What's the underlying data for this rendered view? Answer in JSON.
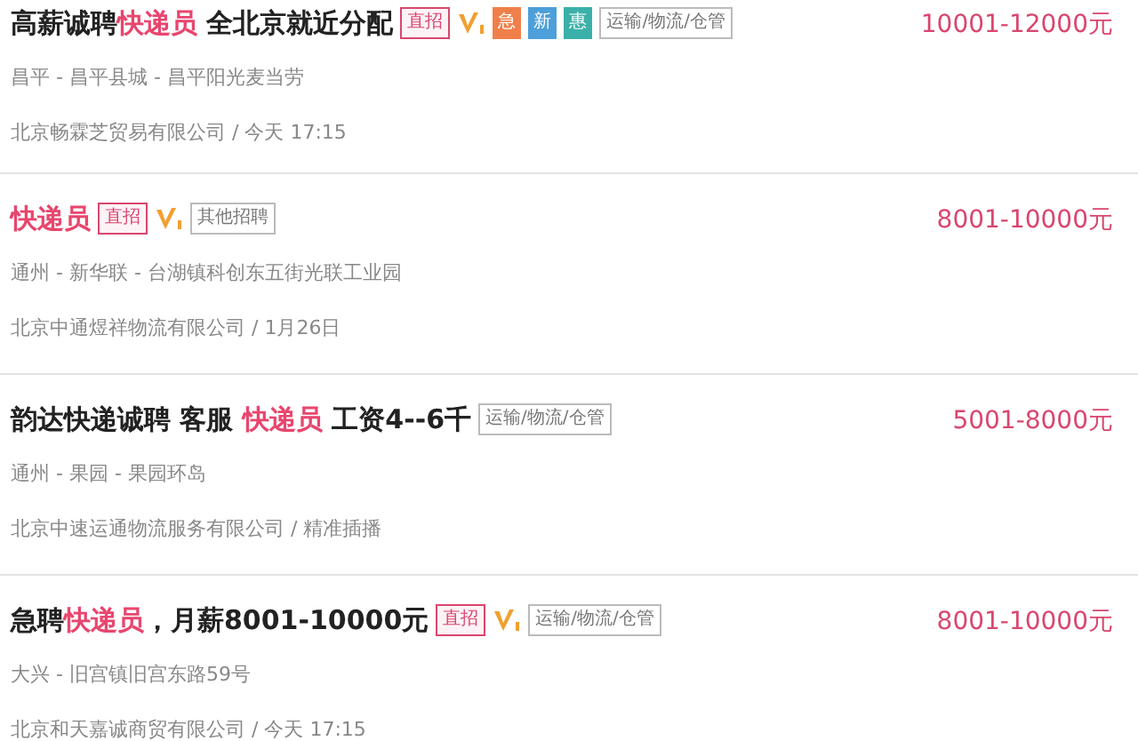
{
  "jobs": [
    {
      "title": [
        {
          "text": "高薪诚聘",
          "highlight": false
        },
        {
          "text": "快递员",
          "highlight": true
        },
        {
          "text": " 全北京就近分配",
          "highlight": false
        }
      ],
      "badges": [
        {
          "kind": "direct",
          "text": "直招"
        },
        {
          "kind": "verified"
        },
        {
          "kind": "urgent",
          "text": "急"
        },
        {
          "kind": "new",
          "text": "新"
        },
        {
          "kind": "benefit",
          "text": "惠"
        },
        {
          "kind": "category",
          "text": "运输/物流/仓管"
        }
      ],
      "salary": "10001-12000元",
      "location": "昌平 - 昌平县城 - 昌平阳光麦当劳",
      "company": "北京畅霖芝贸易有限公司 / 今天 17:15"
    },
    {
      "title": [
        {
          "text": "快递员",
          "highlight": true
        }
      ],
      "badges": [
        {
          "kind": "direct",
          "text": "直招"
        },
        {
          "kind": "verified"
        },
        {
          "kind": "category",
          "text": "其他招聘"
        }
      ],
      "salary": "8001-10000元",
      "location": "通州 - 新华联 - 台湖镇科创东五街光联工业园",
      "company": "北京中通煜祥物流有限公司 / 1月26日"
    },
    {
      "title": [
        {
          "text": "韵达快递诚聘 客服 ",
          "highlight": false
        },
        {
          "text": "快递员",
          "highlight": true
        },
        {
          "text": " 工资4--6千",
          "highlight": false
        }
      ],
      "badges": [
        {
          "kind": "category",
          "text": "运输/物流/仓管"
        }
      ],
      "salary": "5001-8000元",
      "location": "通州 - 果园 - 果园环岛",
      "company": "北京中速运通物流服务有限公司 / 精准插播"
    },
    {
      "title": [
        {
          "text": "急聘",
          "highlight": false
        },
        {
          "text": "快递员",
          "highlight": true
        },
        {
          "text": "，月薪8001-10000元",
          "highlight": false
        }
      ],
      "badges": [
        {
          "kind": "direct",
          "text": "直招"
        },
        {
          "kind": "verified"
        },
        {
          "kind": "category",
          "text": "运输/物流/仓管"
        }
      ],
      "salary": "8001-10000元",
      "location": "大兴 - 旧宫镇旧宫东路59号",
      "company": "北京和天嘉诚商贸有限公司 / 今天 17:15"
    }
  ]
}
